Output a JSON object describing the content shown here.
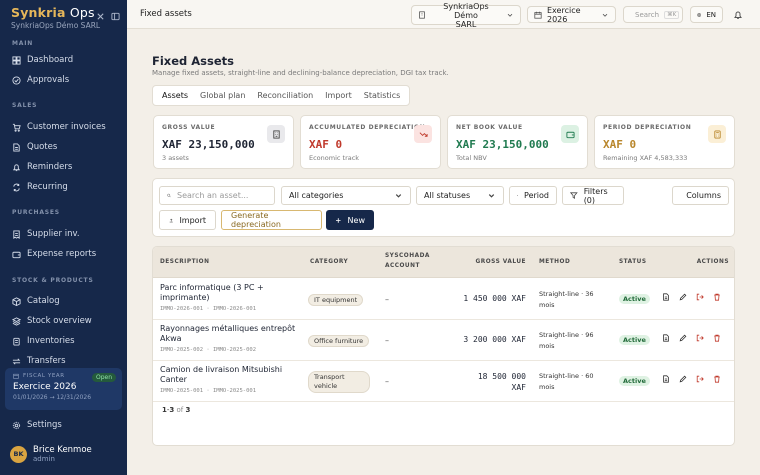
{
  "app": {
    "brand_a": "Synkria",
    "brand_b": "Ops",
    "company": "SynkriaOps Démo SARL"
  },
  "sidebar": {
    "sections": {
      "main": "MAIN",
      "sales": "SALES",
      "purchases": "PURCHASES",
      "stock": "STOCK & PRODUCTS"
    },
    "items": {
      "dashboard": "Dashboard",
      "approvals": "Approvals",
      "customer_invoices": "Customer invoices",
      "quotes": "Quotes",
      "reminders": "Reminders",
      "recurring": "Recurring",
      "supplier_inv": "Supplier inv.",
      "expense_reports": "Expense reports",
      "catalog": "Catalog",
      "stock_overview": "Stock overview",
      "inventories": "Inventories",
      "transfers": "Transfers",
      "settings": "Settings"
    },
    "fiscal": {
      "label": "FISCAL YEAR",
      "badge": "Open",
      "name": "Exercice 2026",
      "range": "01/01/2026 → 12/31/2026"
    },
    "user": {
      "initials": "BK",
      "name": "Brice Kenmoe",
      "role": "admin"
    }
  },
  "topbar": {
    "breadcrumb": "Fixed assets",
    "company_line1": "SynkriaOps Démo",
    "company_line2": "SARL",
    "exercise": "Exercice 2026",
    "search_placeholder": "Search",
    "shortcut": "⌘K",
    "lang": "EN"
  },
  "page": {
    "title": "Fixed Assets",
    "subtitle": "Manage fixed assets, straight-line and declining-balance depreciation, DGI tax track.",
    "tabs": [
      "Assets",
      "Global plan",
      "Reconciliation",
      "Import",
      "Statistics"
    ]
  },
  "kpis": [
    {
      "label": "GROSS VALUE",
      "value": "XAF 23,150,000",
      "sub": "3 assets",
      "color": "#1e2433",
      "icon_bg": "#e9e9ec",
      "icon_color": "#444"
    },
    {
      "label": "ACCUMULATED DEPRECIATION",
      "value": "XAF 0",
      "sub": "Economic track",
      "color": "#c0392b",
      "icon_bg": "#fbe3e1",
      "icon_color": "#c0392b"
    },
    {
      "label": "NET BOOK VALUE",
      "value": "XAF 23,150,000",
      "sub": "Total NBV",
      "color": "#1f7a4f",
      "icon_bg": "#dcf1e3",
      "icon_color": "#1f7a4f"
    },
    {
      "label": "PERIOD DEPRECIATION",
      "value": "XAF 0",
      "sub": "Remaining XAF 4,583,333",
      "color": "#b8862b",
      "icon_bg": "#fbefd6",
      "icon_color": "#b8862b"
    }
  ],
  "filters": {
    "search_placeholder": "Search an asset...",
    "category": "All categories",
    "status": "All statuses",
    "period": "Period",
    "filters": "Filters (0)",
    "columns": "Columns",
    "import": "Import",
    "generate": "Generate depreciation",
    "new": "New"
  },
  "table": {
    "headers": {
      "description": "DESCRIPTION",
      "category": "CATEGORY",
      "account_1": "SYSCOHADA",
      "account_2": "ACCOUNT",
      "gross": "GROSS VALUE",
      "method": "METHOD",
      "status": "STATUS",
      "actions": "ACTIONS"
    },
    "rows": [
      {
        "desc": "Parc informatique (3 PC + imprimante)",
        "code1": "IMMO-2026-001",
        "code2": "IMMO-2026-001",
        "category": "IT equipment",
        "account": "–",
        "gross": "1 450 000 XAF",
        "method": "Straight-line · 36 mois",
        "status": "Active"
      },
      {
        "desc": "Rayonnages métalliques entrepôt Akwa",
        "code1": "IMMO-2025-002",
        "code2": "IMMO-2025-002",
        "category": "Office furniture",
        "account": "–",
        "gross": "3 200 000 XAF",
        "method": "Straight-line · 96 mois",
        "status": "Active"
      },
      {
        "desc": "Camion de livraison Mitsubishi Canter",
        "code1": "IMMO-2025-001",
        "code2": "IMMO-2025-001",
        "category": "Transport vehicle",
        "account": "–",
        "gross": "18 500 000 XAF",
        "method": "Straight-line · 60 mois",
        "status": "Active"
      }
    ],
    "pager": {
      "from": "1",
      "to": "3",
      "of": "of",
      "total": "3"
    }
  }
}
